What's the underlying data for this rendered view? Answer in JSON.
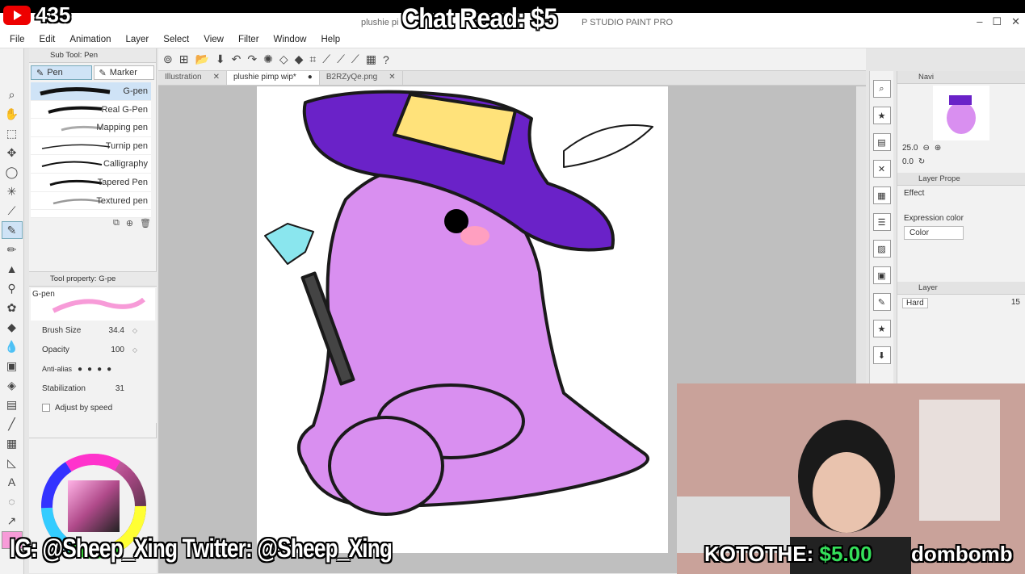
{
  "stream": {
    "view_count": "435",
    "chat_read": "Chat Read: $5",
    "socials": "IG: @Sheep_Xing  Twitter: @Sheep_Xing",
    "donation_name": "KOTOTHE:",
    "donation_amount": "$5.00",
    "ticker_text": "dombomb"
  },
  "window": {
    "title_left": "plushie pi",
    "title_right": "P STUDIO PAINT PRO"
  },
  "menu": [
    "File",
    "Edit",
    "Animation",
    "Layer",
    "Select",
    "View",
    "Filter",
    "Window",
    "Help"
  ],
  "subtool": {
    "title": "Sub Tool: Pen",
    "tabs": [
      "Pen",
      "Marker"
    ],
    "pens": [
      "G-pen",
      "Real G-Pen",
      "Mapping pen",
      "Turnip pen",
      "Calligraphy",
      "Tapered Pen",
      "Textured pen"
    ]
  },
  "toolprop": {
    "title": "Tool property: G-pe",
    "current": "G-pen",
    "brush_size_label": "Brush Size",
    "brush_size": "34.4",
    "opacity_label": "Opacity",
    "opacity": "100",
    "antialias_label": "Anti-alias",
    "stabilization_label": "Stabilization",
    "stabilization": "31",
    "adjust_label": "Adjust by speed"
  },
  "doc_tabs": [
    {
      "label": "Illustration",
      "active": false
    },
    {
      "label": "plushie pimp wip*",
      "active": true
    },
    {
      "label": "B2RZyQe.png",
      "active": false
    }
  ],
  "navigator": {
    "title": "Navi",
    "zoom": "25.0",
    "rotation": "0.0"
  },
  "layer_property": {
    "title": "Layer Prope",
    "effect_label": "Effect",
    "expression_label": "Expression color",
    "expression_value": "Color"
  },
  "layer_panel": {
    "title": "Layer",
    "blend": "Hard",
    "opacity": "15"
  },
  "colors": {
    "main_color": "#f79bd8",
    "plushie": "#d98ff0",
    "hat": "#6a22c8",
    "hat_band": "#ffe27a",
    "gem": "#8ae6ee"
  }
}
